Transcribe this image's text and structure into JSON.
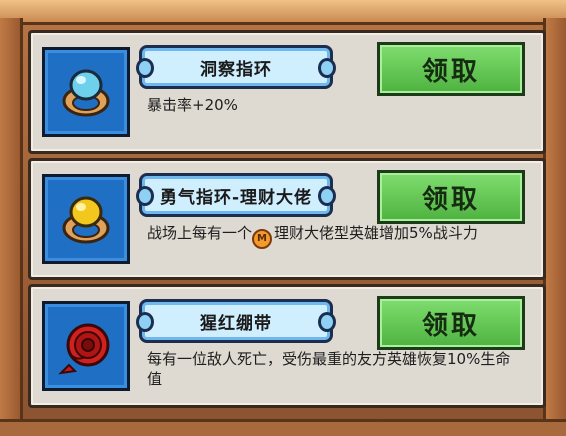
{
  "rewards": [
    {
      "title": "洞察指环",
      "icon": "blue-gem-ring-icon",
      "description": "暴击率+20%",
      "claim_label": "领取"
    },
    {
      "title": "勇气指环-理财大佬",
      "icon": "yellow-gem-ring-icon",
      "description_before": "战场上每有一个",
      "description_badge": "M",
      "description_after": "理财大佬型英雄增加5%战斗力",
      "claim_label": "领取"
    },
    {
      "title": "猩红绷带",
      "icon": "red-bandage-icon",
      "description": "每有一位敌人死亡，受伤最重的友方英雄恢复10%生命值",
      "claim_label": "领取"
    }
  ],
  "colors": {
    "card_bg": "#dedad2",
    "icon_bg": "#1f6fc4",
    "banner_bg": "#cfefff",
    "claim_green": "#5cc14c",
    "frame_wood": "#b87444"
  }
}
